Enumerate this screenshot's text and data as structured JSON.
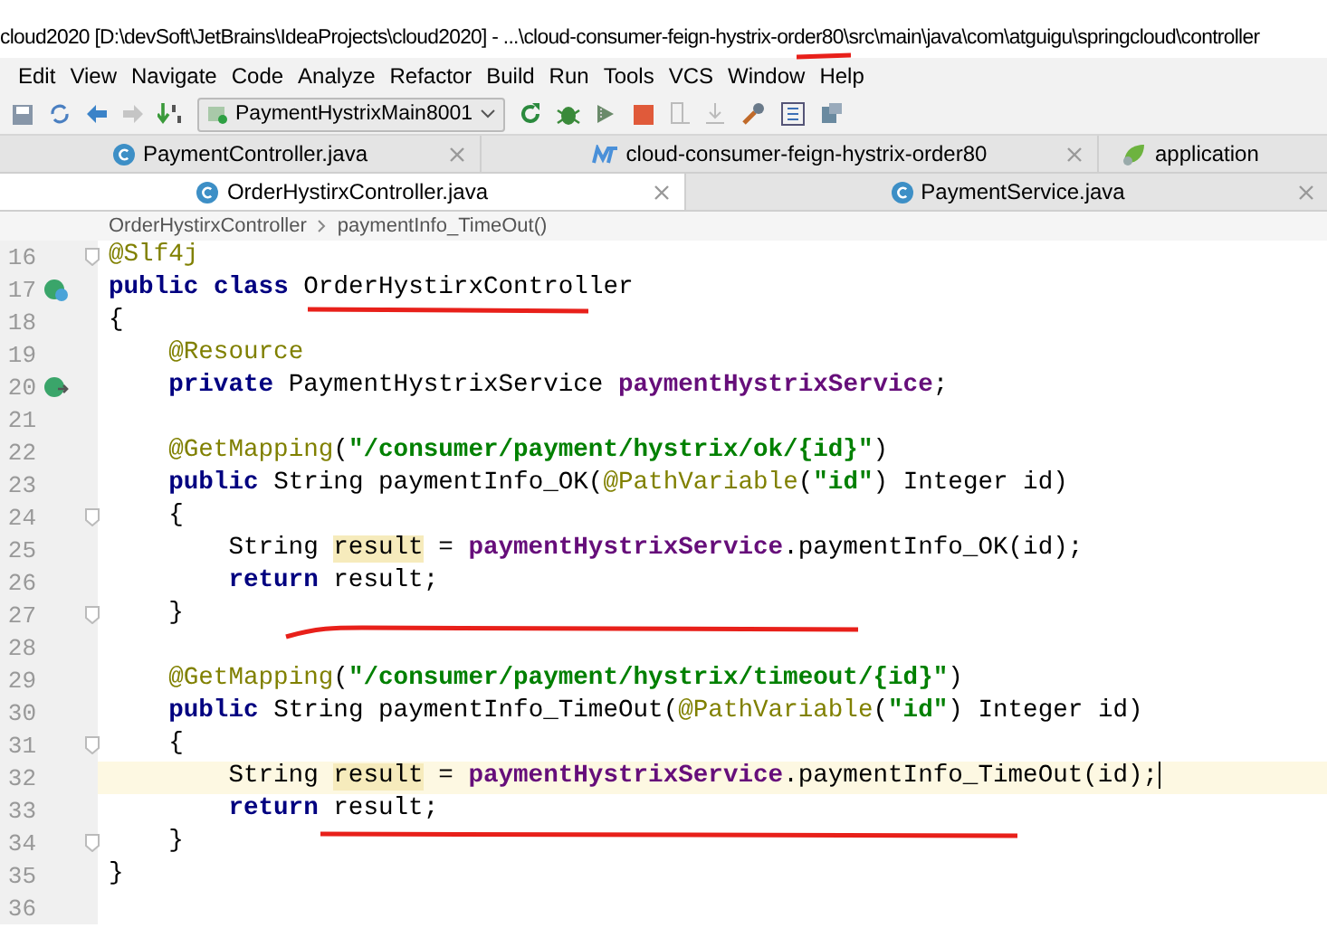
{
  "window": {
    "title": "cloud2020 [D:\\devSoft\\JetBrains\\IdeaProjects\\cloud2020] - ...\\cloud-consumer-feign-hystrix-order80\\src\\main\\java\\com\\atguigu\\springcloud\\controller"
  },
  "menu": [
    "Edit",
    "View",
    "Navigate",
    "Code",
    "Analyze",
    "Refactor",
    "Build",
    "Run",
    "Tools",
    "VCS",
    "Window",
    "Help"
  ],
  "toolbar": {
    "run_config": "PaymentHystrixMain8001"
  },
  "tabs": [
    [
      {
        "label": "PaymentController.java",
        "kind": "class",
        "selected": false
      },
      {
        "label": "cloud-consumer-feign-hystrix-order80",
        "kind": "maven",
        "selected": false
      },
      {
        "label": "application",
        "kind": "spring",
        "selected": false
      }
    ],
    [
      {
        "label": "OrderHystirxController.java",
        "kind": "class",
        "selected": true
      },
      {
        "label": "PaymentService.java",
        "kind": "class",
        "selected": false
      }
    ]
  ],
  "breadcrumb": [
    "OrderHystirxController",
    "paymentInfo_TimeOut()"
  ],
  "code": [
    {
      "no": "16",
      "fold": true,
      "current": false,
      "tokens": [
        {
          "kind": "ann",
          "text": "@Slf4j"
        }
      ]
    },
    {
      "no": "17",
      "kind": "class",
      "fold": false,
      "current": false,
      "tokens": [
        {
          "kind": "kw",
          "text": "public class "
        },
        {
          "kind": "plain",
          "text": "OrderHystirxController"
        }
      ]
    },
    {
      "no": "18",
      "fold": false,
      "current": false,
      "tokens": [
        {
          "kind": "plain",
          "text": "{"
        }
      ],
      "children": [
        {
          "no": "19",
          "fold": false,
          "current": false,
          "tokens": [
            {
              "kind": "ann",
              "text": "@Resource"
            }
          ]
        },
        {
          "no": "20",
          "kind": "bean",
          "fold": false,
          "current": false,
          "tokens": [
            {
              "kind": "kw",
              "text": "private "
            },
            {
              "kind": "plain",
              "text": "PaymentHystrixService "
            },
            {
              "kind": "field",
              "text": "paymentHystrixService"
            },
            {
              "kind": "plain",
              "text": ";"
            }
          ]
        },
        {
          "no": "21",
          "fold": false,
          "current": false
        },
        {
          "no": "22",
          "fold": false,
          "current": false,
          "tokens": [
            {
              "kind": "ann",
              "text": "@GetMapping"
            },
            {
              "kind": "plain",
              "text": "("
            },
            {
              "kind": "str",
              "text": "\"/consumer/payment/hystrix/ok/{id}\""
            },
            {
              "kind": "plain",
              "text": ")"
            }
          ]
        },
        {
          "no": "23",
          "fold": false,
          "current": false,
          "tokens": [
            {
              "kind": "kw",
              "text": "public "
            },
            {
              "kind": "plain",
              "text": "String paymentInfo_OK("
            },
            {
              "kind": "ann",
              "text": "@PathVariable"
            },
            {
              "kind": "plain",
              "text": "("
            },
            {
              "kind": "str",
              "text": "\"id\""
            },
            {
              "kind": "plain",
              "text": ") Integer id)"
            }
          ]
        },
        {
          "no": "24",
          "fold": true,
          "current": false,
          "tokens": [
            {
              "kind": "plain",
              "text": "{"
            }
          ],
          "children": [
            {
              "no": "25",
              "fold": false,
              "current": false,
              "tokens": [
                {
                  "kind": "plain",
                  "text": "String "
                },
                {
                  "kind": "hl",
                  "text": "result"
                },
                {
                  "kind": "plain",
                  "text": " = "
                },
                {
                  "kind": "field",
                  "text": "paymentHystrixService"
                },
                {
                  "kind": "plain",
                  "text": ".paymentInfo_OK(id);"
                }
              ]
            },
            {
              "no": "26",
              "fold": false,
              "current": false,
              "tokens": [
                {
                  "kind": "kw",
                  "text": "return "
                },
                {
                  "kind": "plain",
                  "text": "result;"
                }
              ]
            }
          ]
        },
        {
          "no": "27",
          "fold": true,
          "current": false,
          "tokens": [
            {
              "kind": "plain",
              "text": "}"
            }
          ]
        },
        {
          "no": "28",
          "fold": false,
          "current": false
        },
        {
          "no": "29",
          "fold": false,
          "current": false,
          "tokens": [
            {
              "kind": "ann",
              "text": "@GetMapping"
            },
            {
              "kind": "plain",
              "text": "("
            },
            {
              "kind": "str",
              "text": "\"/consumer/payment/hystrix/timeout/{id}\""
            },
            {
              "kind": "plain",
              "text": ")"
            }
          ]
        },
        {
          "no": "30",
          "fold": false,
          "current": false,
          "tokens": [
            {
              "kind": "kw",
              "text": "public "
            },
            {
              "kind": "plain",
              "text": "String paymentInfo_TimeOut("
            },
            {
              "kind": "ann",
              "text": "@PathVariable"
            },
            {
              "kind": "plain",
              "text": "("
            },
            {
              "kind": "str",
              "text": "\"id\""
            },
            {
              "kind": "plain",
              "text": ") Integer id)"
            }
          ]
        },
        {
          "no": "31",
          "fold": true,
          "current": false,
          "tokens": [
            {
              "kind": "plain",
              "text": "{"
            }
          ],
          "children": [
            {
              "no": "32",
              "fold": false,
              "current": true,
              "tokens": [
                {
                  "kind": "plain",
                  "text": "String "
                },
                {
                  "kind": "hl",
                  "text": "result"
                },
                {
                  "kind": "plain",
                  "text": " = "
                },
                {
                  "kind": "field",
                  "text": "paymentHystrixService"
                },
                {
                  "kind": "plain",
                  "text": ".paymentInfo_TimeOut(id);"
                }
              ]
            },
            {
              "no": "33",
              "fold": false,
              "current": false,
              "tokens": [
                {
                  "kind": "kw",
                  "text": "return "
                },
                {
                  "kind": "plain",
                  "text": "result;"
                }
              ]
            }
          ]
        },
        {
          "no": "34",
          "fold": true,
          "current": false,
          "tokens": [
            {
              "kind": "plain",
              "text": "}"
            }
          ]
        }
      ]
    },
    {
      "no": "35",
      "fold": false,
      "current": false,
      "tokens": [
        {
          "kind": "plain",
          "text": "}"
        }
      ]
    },
    {
      "no": "36",
      "fold": false,
      "current": false
    }
  ]
}
